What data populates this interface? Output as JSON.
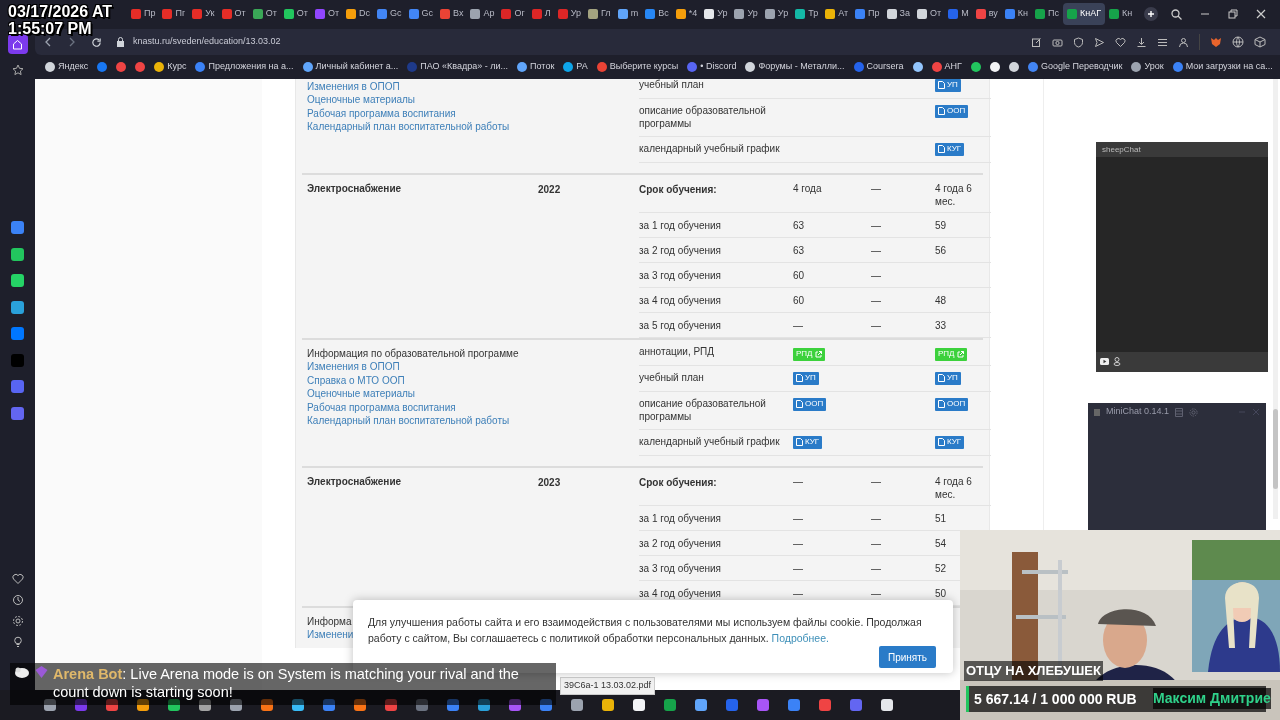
{
  "stream_overlay": {
    "timestamp": [
      "03/17/2026 AT",
      "1:55:07 PM"
    ]
  },
  "tabs": [
    {
      "label": "Пр",
      "color": "#e52d27",
      "selected": false
    },
    {
      "label": "Пг",
      "color": "#e52d27",
      "selected": false
    },
    {
      "label": "Ук",
      "color": "#e52d27",
      "selected": false
    },
    {
      "label": "От",
      "color": "#e52d27",
      "selected": false
    },
    {
      "label": "От",
      "color": "#3aa757",
      "selected": false
    },
    {
      "label": "От",
      "color": "#22c55e",
      "selected": false
    },
    {
      "label": "От",
      "color": "#9146ff",
      "selected": false
    },
    {
      "label": "Dc",
      "color": "#f59e0b",
      "selected": false
    },
    {
      "label": "Gc",
      "color": "#4285f4",
      "selected": false
    },
    {
      "label": "Gc",
      "color": "#4285f4",
      "selected": false
    },
    {
      "label": "Вх",
      "color": "#ea4335",
      "selected": false
    },
    {
      "label": "Ар",
      "color": "#9ca3af",
      "selected": false
    },
    {
      "label": "Ог",
      "color": "#dc2626",
      "selected": false
    },
    {
      "label": "Л",
      "color": "#dc2626",
      "selected": false
    },
    {
      "label": "Ур",
      "color": "#dc2626",
      "selected": false
    },
    {
      "label": "Гл",
      "color": "#a3a380",
      "selected": false
    },
    {
      "label": "m",
      "color": "#60a5fa",
      "selected": false
    },
    {
      "label": "Вс",
      "color": "#2787f5",
      "selected": false
    },
    {
      "label": "*4",
      "color": "#f59e0b",
      "selected": false
    },
    {
      "label": "Ур",
      "color": "#e5e7eb",
      "selected": false
    },
    {
      "label": "Ур",
      "color": "#9ca3af",
      "selected": false
    },
    {
      "label": "Ур",
      "color": "#9ca3af",
      "selected": false
    },
    {
      "label": "Тр",
      "color": "#14b8a6",
      "selected": false
    },
    {
      "label": "Ат",
      "color": "#eab308",
      "selected": false
    },
    {
      "label": "Пр",
      "color": "#3b82f6",
      "selected": false
    },
    {
      "label": "За",
      "color": "#d1d5db",
      "selected": false
    },
    {
      "label": "От",
      "color": "#d1d5db",
      "selected": false
    },
    {
      "label": "M",
      "color": "#2563eb",
      "selected": false
    },
    {
      "label": "ву",
      "color": "#ef4444",
      "selected": false
    },
    {
      "label": "Кн",
      "color": "#3b82f6",
      "selected": false
    },
    {
      "label": "Пс",
      "color": "#16a34a",
      "selected": false
    },
    {
      "label": "КнАГ",
      "color": "#16a34a",
      "selected": true
    },
    {
      "label": "Кн",
      "color": "#16a34a",
      "selected": false
    }
  ],
  "address_bar": {
    "url": "knastu.ru/sveden/education/13.03.02"
  },
  "bookmarks": [
    {
      "label": "Яндекс",
      "color": "#d1d5db"
    },
    {
      "color": "#1877f2"
    },
    {
      "color": "#ef4444"
    },
    {
      "color": "#ef4444"
    },
    {
      "label": "Курс",
      "color": "#eab308"
    },
    {
      "label": "Предложения на а...",
      "color": "#3b82f6"
    },
    {
      "label": "Личный кабинет а...",
      "color": "#60a5fa"
    },
    {
      "label": "ПАО «Квадра» - ли...",
      "color": "#1e3a8a"
    },
    {
      "label": "Поток",
      "color": "#60a5fa"
    },
    {
      "label": "РА",
      "color": "#0ea5e9"
    },
    {
      "label": "Выберите курсы",
      "color": "#ea4335"
    },
    {
      "label": "• Discord",
      "color": "#5865f2"
    },
    {
      "label": "Форумы - Металли...",
      "color": "#d1d5db"
    },
    {
      "label": "Coursera",
      "color": "#2563eb"
    },
    {
      "color": "#93c5fd"
    },
    {
      "label": "АНГ",
      "color": "#ef4444"
    },
    {
      "color": "#22c55e"
    },
    {
      "color": "#f3f4f6"
    },
    {
      "color": "#d1d5db"
    },
    {
      "label": "Google Переводчик",
      "color": "#4285f4"
    },
    {
      "label": "Урок",
      "color": "#9ca3af"
    },
    {
      "label": "Мои загрузки на са...",
      "color": "#3b82f6"
    }
  ],
  "table": {
    "sections": [
      {
        "kind": "docs",
        "links": [
          "Изменения в ОПОП",
          "Оценочные материалы",
          "Рабочая программа воспитания",
          "Календарный план воспитательной работы"
        ],
        "rows": [
          {
            "label": "учебный план",
            "button_2": {
              "kind": "pdf",
              "label": "УП"
            }
          },
          {
            "label": "описание образовательной программы",
            "button_2": {
              "kind": "pdf",
              "label": "ООП"
            }
          },
          {
            "label": "календарный учебный график",
            "button_2": {
              "kind": "pdf",
              "label": "КУГ"
            }
          }
        ]
      },
      {
        "kind": "program",
        "name": "Электроснабжение",
        "year": "2022",
        "rows": [
          {
            "label": "Срок обучения:",
            "kind": "term",
            "values": [
              "4 года",
              "—",
              "4 года 6 мес."
            ]
          },
          {
            "label": "за 1 год обучения",
            "values": [
              "63",
              "—",
              "59"
            ]
          },
          {
            "label": "за 2 год обучения",
            "values": [
              "63",
              "—",
              "56"
            ]
          },
          {
            "label": "за 3 год обучения",
            "values": [
              "60",
              "—"
            ]
          },
          {
            "label": "за 4 год обучения",
            "values": [
              "60",
              "—",
              "48"
            ]
          },
          {
            "label": "за 5 год обучения",
            "values": [
              "—",
              "—",
              "33"
            ]
          }
        ]
      },
      {
        "kind": "docs",
        "title": "Информация по образовательной программе",
        "links": [
          "Изменения в ОПОП",
          "Справка о МТО ООП",
          "Оценочные материалы",
          "Рабочая программа воспитания",
          "Календарный план воспитательной работы"
        ],
        "rows": [
          {
            "label": "аннотации, РПД",
            "button_1": {
              "kind": "external",
              "label": "РПД"
            },
            "button_2": {
              "kind": "external",
              "label": "РПД"
            }
          },
          {
            "label": "учебный план",
            "button_1": {
              "kind": "pdf",
              "label": "УП"
            },
            "button_2": {
              "kind": "pdf",
              "label": "УП"
            }
          },
          {
            "label": "описание образовательной программы",
            "button_1": {
              "kind": "pdf",
              "label": "ООП"
            },
            "button_2": {
              "kind": "pdf",
              "label": "ООП"
            }
          },
          {
            "label": "календарный учебный график",
            "button_1": {
              "kind": "pdf",
              "label": "КУГ"
            },
            "button_2": {
              "kind": "pdf",
              "label": "КУГ"
            }
          }
        ]
      },
      {
        "kind": "program",
        "name": "Электроснабжение",
        "year": "2023",
        "rows": [
          {
            "label": "Срок обучения:",
            "kind": "term",
            "values": [
              "—",
              "—",
              "4 года 6 мес."
            ]
          },
          {
            "label": "за 1 год обучения",
            "values": [
              "—",
              "—",
              "51"
            ]
          },
          {
            "label": "за 2 год обучения",
            "values": [
              "—",
              "—",
              "54"
            ]
          },
          {
            "label": "за 3 год обучения",
            "values": [
              "—",
              "—",
              "52"
            ]
          },
          {
            "label": "за 4 год обучения",
            "values": [
              "—",
              "—",
              "50"
            ]
          }
        ]
      },
      {
        "kind": "docs",
        "title": "Информа",
        "links": [
          "Изменени"
        ]
      }
    ]
  },
  "cookie_banner": {
    "text": "Для улучшения работы сайта и его взаимодействия с пользователями мы используем файлы cookie. Продолжая работу с сайтом, Вы соглашаетесь с политикой обработки персональных данных.",
    "link": "Подробнее.",
    "button": "Принять"
  },
  "status_bar": {
    "url": "39С6а-1 13.03.02.pdf"
  },
  "sheep_chat": {
    "title": "sheepChat"
  },
  "mini_chat": {
    "title": "MiniChat 0.14.1"
  },
  "chat_alert": {
    "user": "Arena Bot",
    "message": ": Live Arena mode is on System is matching your rival and the count down is starting soon!"
  },
  "webcam": {
    "caption": "ОТЦУ НА ХЛЕБУШЕК",
    "goal": {
      "text": "5 667.14 / 1 000 000 RUB",
      "level": 0.0057
    },
    "donor": "Максим Дмитрие"
  }
}
